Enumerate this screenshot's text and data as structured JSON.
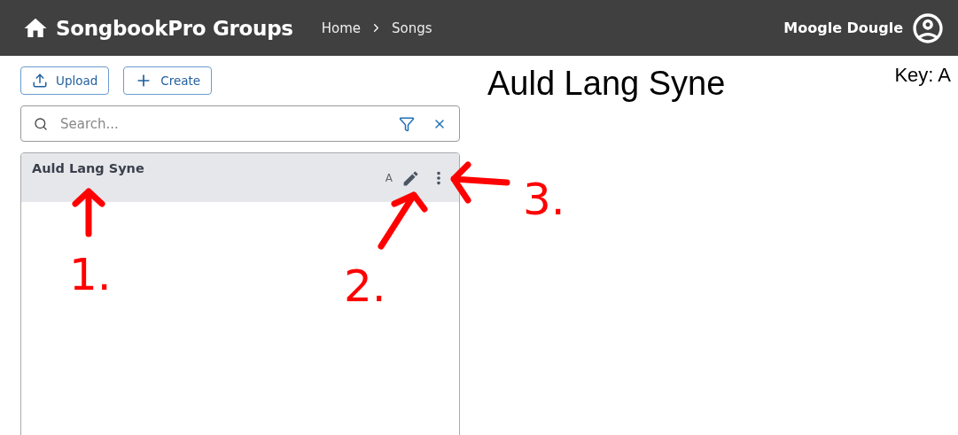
{
  "header": {
    "title": "SongbookPro Groups",
    "breadcrumbs": [
      "Home",
      "Songs"
    ],
    "user": "Moogle Dougle"
  },
  "actions": [
    {
      "label": "Upload",
      "kind": "upload"
    },
    {
      "label": "Create",
      "kind": "create"
    }
  ],
  "search": {
    "placeholder": "Search..."
  },
  "songs": [
    {
      "title": "Auld Lang Syne",
      "key": "A",
      "selected": true
    }
  ],
  "song_view": {
    "title": "Auld Lang Syne",
    "key": "Key: A"
  },
  "annotations": [
    {
      "label": "1."
    },
    {
      "label": "2."
    },
    {
      "label": "3."
    }
  ]
}
